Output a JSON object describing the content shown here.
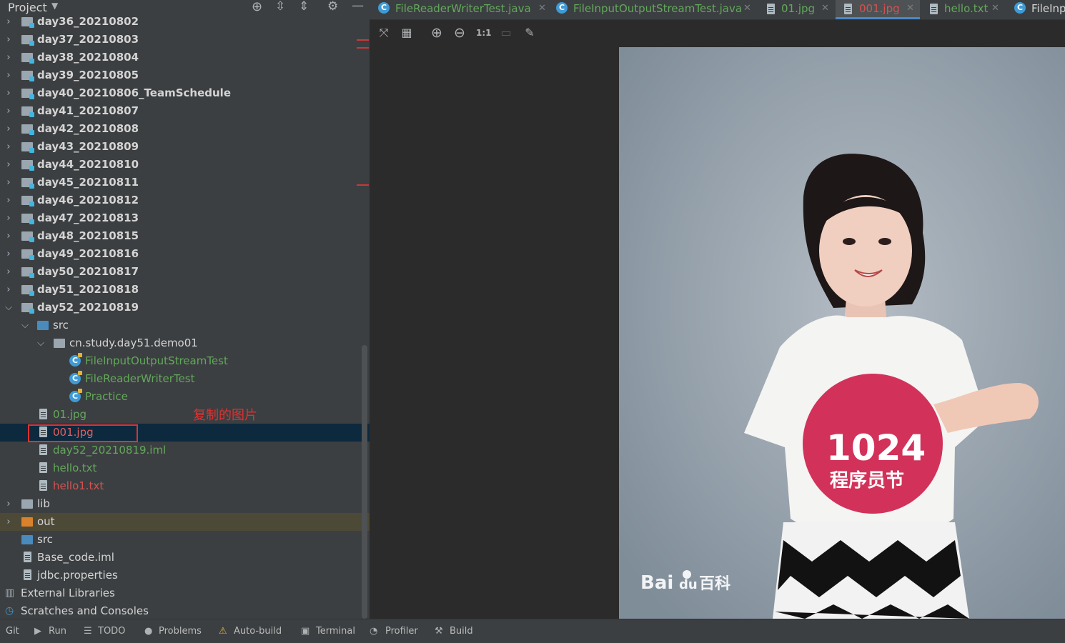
{
  "project_header": {
    "title": "Project"
  },
  "tree": {
    "day_folders": [
      "day36_20210802",
      "day37_20210803",
      "day38_20210804",
      "day39_20210805",
      "day40_20210806_TeamSchedule",
      "day41_20210807",
      "day42_20210808",
      "day43_20210809",
      "day44_20210810",
      "day45_20210811",
      "day46_20210812",
      "day47_20210813",
      "day48_20210815",
      "day49_20210816",
      "day50_20210817",
      "day51_20210818",
      "day52_20210819"
    ],
    "src": "src",
    "package": "cn.study.day51.demo01",
    "classes": [
      "FileInputOutputStreamTest",
      "FileReaderWriterTest",
      "Practice"
    ],
    "files": {
      "f01": "01.jpg",
      "f001": "001.jpg",
      "iml": "day52_20210819.iml",
      "hello": "hello.txt",
      "hello1": "hello1.txt"
    },
    "lib": "lib",
    "out": "out",
    "root_src": "src",
    "base_iml": "Base_code.iml",
    "jdbc": "jdbc.properties",
    "external": "External Libraries",
    "scratches": "Scratches and Consoles"
  },
  "annotation": {
    "text": "复制的图片"
  },
  "tabs": [
    {
      "label": "FileReaderWriterTest.java"
    },
    {
      "label": "FileInputOutputStreamTest.java"
    },
    {
      "label": "01.jpg"
    },
    {
      "label": "001.jpg"
    },
    {
      "label": "hello.txt"
    },
    {
      "label": "FileInp"
    }
  ],
  "toolbar": {
    "actual_size": "1:1"
  },
  "image": {
    "watermark_a": "Bai",
    "watermark_b": "du",
    "watermark_c": "百科",
    "shirt_line1": "1024",
    "shirt_line2": "程序员节"
  },
  "status_bar": {
    "git": "Git",
    "run": "Run",
    "todo": "TODO",
    "problems": "Problems",
    "autobuild": "Auto-build",
    "terminal": "Terminal",
    "profiler": "Profiler",
    "build": "Build"
  },
  "colors": {
    "accent": "#4a88c7",
    "selection": "#0d293e",
    "annotation": "#e03131"
  }
}
